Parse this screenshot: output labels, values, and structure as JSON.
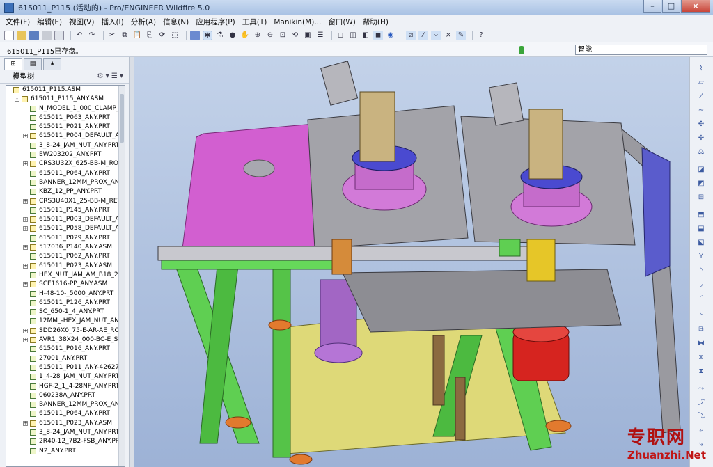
{
  "window": {
    "title": "615011_P115 (活动的) - Pro/ENGINEER Wildfire 5.0",
    "close": "×",
    "min": "–",
    "max": "□"
  },
  "menu": [
    "文件(F)",
    "编辑(E)",
    "视图(V)",
    "插入(I)",
    "分析(A)",
    "信息(N)",
    "应用程序(P)",
    "工具(T)",
    "Manikin(M)...",
    "窗口(W)",
    "帮助(H)"
  ],
  "message": "615011_P115已存盘。",
  "filter": {
    "value": "智能"
  },
  "panel": {
    "header": "模型树",
    "tools": "⚙ ▾  ☰ ▾"
  },
  "tree": [
    {
      "label": "615011_P115.ASM",
      "level": 0,
      "type": "asm",
      "expander": ""
    },
    {
      "label": "615011_P115_ANY.ASM",
      "level": 1,
      "type": "asm",
      "expander": "-"
    },
    {
      "label": "N_MODEL_1_000_CLAMP_ANY",
      "level": 2,
      "type": "part",
      "expander": ""
    },
    {
      "label": "615011_P063_ANY.PRT",
      "level": 2,
      "type": "part",
      "expander": ""
    },
    {
      "label": "615011_P021_ANY.PRT",
      "level": 2,
      "type": "part",
      "expander": ""
    },
    {
      "label": "615011_P004_DEFAULT_AS_M",
      "level": 2,
      "type": "asm",
      "expander": "+"
    },
    {
      "label": "3_8-24_JAM_NUT_ANY.PRT",
      "level": 2,
      "type": "part",
      "expander": ""
    },
    {
      "label": "EW203202_ANY.PRT",
      "level": 2,
      "type": "part",
      "expander": ""
    },
    {
      "label": "CRS3U32X_625-BB-M_ROD_R",
      "level": 2,
      "type": "asm",
      "expander": "+"
    },
    {
      "label": "615011_P064_ANY.PRT",
      "level": 2,
      "type": "part",
      "expander": ""
    },
    {
      "label": "BANNER_12MM_PROX_ANY.P",
      "level": 2,
      "type": "part",
      "expander": ""
    },
    {
      "label": "KBZ_12_PP_ANY.PRT",
      "level": 2,
      "type": "part",
      "expander": ""
    },
    {
      "label": "CRS3U40X1_25-BB-M_RETRA",
      "level": 2,
      "type": "asm",
      "expander": "+"
    },
    {
      "label": "615011_P145_ANY.PRT",
      "level": 2,
      "type": "part",
      "expander": ""
    },
    {
      "label": "615011_P003_DEFAULT_AS_M",
      "level": 2,
      "type": "asm",
      "expander": "+"
    },
    {
      "label": "615011_P058_DEFAULT_AS_M",
      "level": 2,
      "type": "asm",
      "expander": "+"
    },
    {
      "label": "615011_P029_ANY.PRT",
      "level": 2,
      "type": "part",
      "expander": ""
    },
    {
      "label": "517036_P140_ANY.ASM",
      "level": 2,
      "type": "asm",
      "expander": "+"
    },
    {
      "label": "615011_P062_ANY.PRT",
      "level": 2,
      "type": "part",
      "expander": ""
    },
    {
      "label": "615011_P023_ANY.ASM",
      "level": 2,
      "type": "asm",
      "expander": "+"
    },
    {
      "label": "HEX_NUT_JAM_AM_B18_2_4_5",
      "level": 2,
      "type": "part",
      "expander": ""
    },
    {
      "label": "SCE1616-PP_ANY.ASM",
      "level": 2,
      "type": "asm",
      "expander": "+"
    },
    {
      "label": "H-48-10-_5000_ANY.PRT",
      "level": 2,
      "type": "part",
      "expander": ""
    },
    {
      "label": "615011_P126_ANY.PRT",
      "level": 2,
      "type": "part",
      "expander": ""
    },
    {
      "label": "SC_650-1_4_ANY.PRT",
      "level": 2,
      "type": "part",
      "expander": ""
    },
    {
      "label": "12MM_-HEX_JAM_NUT_ANY.P",
      "level": 2,
      "type": "part",
      "expander": ""
    },
    {
      "label": "SDD26X0_75-E-AR-AE_ROD_E",
      "level": 2,
      "type": "asm",
      "expander": "+"
    },
    {
      "label": "AVR1_38X24_000-BC-E_STROI",
      "level": 2,
      "type": "asm",
      "expander": "+"
    },
    {
      "label": "615011_P016_ANY.PRT",
      "level": 2,
      "type": "part",
      "expander": ""
    },
    {
      "label": "27001_ANY.PRT",
      "level": 2,
      "type": "part",
      "expander": ""
    },
    {
      "label": "615011_P011_ANY-426279.PR",
      "level": 2,
      "type": "part",
      "expander": ""
    },
    {
      "label": "1_4-28_JAM_NUT_ANY.PRT",
      "level": 2,
      "type": "part",
      "expander": ""
    },
    {
      "label": "HGF-2_1_4-28NF_ANY.PRT",
      "level": 2,
      "type": "part",
      "expander": ""
    },
    {
      "label": "060238A_ANY.PRT",
      "level": 2,
      "type": "part",
      "expander": ""
    },
    {
      "label": "BANNER_12MM_PROX_ANY.P",
      "level": 2,
      "type": "part",
      "expander": ""
    },
    {
      "label": "615011_P064_ANY.PRT",
      "level": 2,
      "type": "part",
      "expander": ""
    },
    {
      "label": "615011_P023_ANY.ASM",
      "level": 2,
      "type": "asm",
      "expander": "+"
    },
    {
      "label": "3_8-24_JAM_NUT_ANY.PRT",
      "level": 2,
      "type": "part",
      "expander": ""
    },
    {
      "label": "2R40-12_7B2-FSB_ANY.PRT",
      "level": 2,
      "type": "part",
      "expander": ""
    },
    {
      "label": "N2_ANY.PRT",
      "level": 2,
      "type": "part",
      "expander": ""
    }
  ],
  "watermark": {
    "cn": "专职网",
    "en": "Zhuanzhi.Net"
  },
  "colors": {
    "magenta": "#d25fd0",
    "green": "#5fcf52",
    "yellow": "#ded978",
    "gray": "#8d8d93",
    "purple": "#a266c4",
    "red": "#d6241f",
    "blue": "#5a5ccc"
  }
}
